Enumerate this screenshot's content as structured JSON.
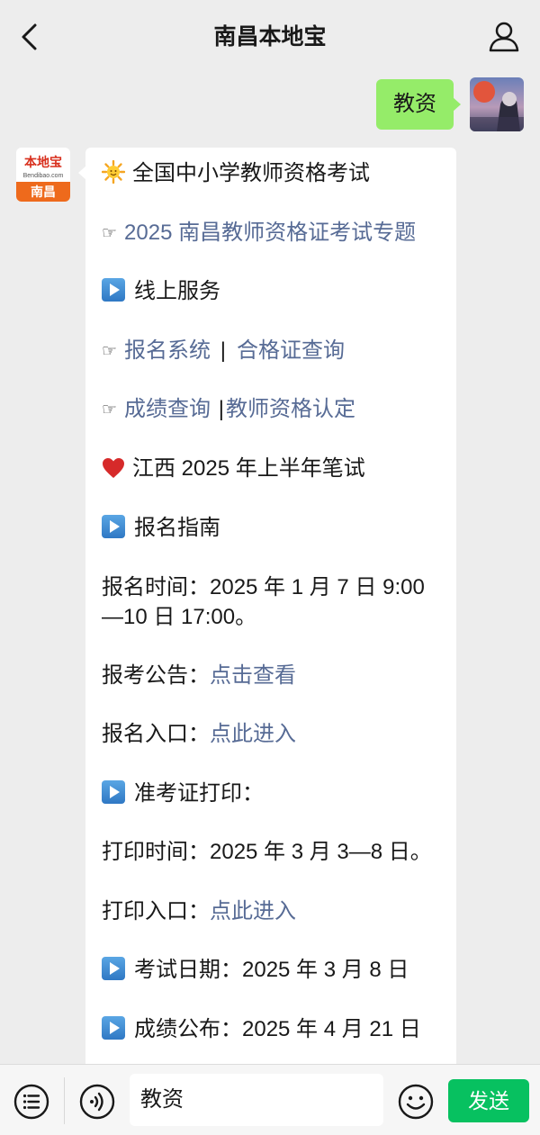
{
  "header": {
    "title": "南昌本地宝"
  },
  "user_message": {
    "text": "教资"
  },
  "bot": {
    "avatar_logo": "本地宝",
    "avatar_sub": "Bendibao.com",
    "avatar_city": "南昌",
    "lines": {
      "l1": "全国中小学教师资格考试",
      "l2_link": "2025 南昌教师资格证考试专题",
      "l3": "线上服务",
      "l4_link1": "报名系统",
      "l4_sep": "|",
      "l4_link2": "合格证查询",
      "l5_link1": "成绩查询",
      "l5_sep": "|",
      "l5_link2": "教师资格认定",
      "l6": "江西 2025 年上半年笔试",
      "l7": "报名指南",
      "l8": "报名时间：2025 年 1 月 7 日 9:00—10 日 17:00。",
      "l9_label": "报考公告：",
      "l9_link": "点击查看",
      "l10_label": "报名入口：",
      "l10_link": "点此进入",
      "l11": "准考证打印：",
      "l12": "打印时间：2025 年 3 月 3—8 日。",
      "l13_label": "打印入口：",
      "l13_link": "点此进入",
      "l14": "考试日期：2025 年 3 月 8 日",
      "l15": "成绩公布：2025 年 4 月 21 日"
    }
  },
  "input": {
    "value": "教资"
  },
  "send_label": "发送",
  "colors": {
    "link": "#576b95",
    "send": "#07c160",
    "user_bubble": "#95ec69"
  },
  "icons": [
    "back-chevron-icon",
    "user-profile-icon",
    "sun-emoji-icon",
    "pointing-hand-icon",
    "play-button-icon",
    "heart-icon",
    "menu-list-icon",
    "voice-icon",
    "emoji-face-icon"
  ]
}
